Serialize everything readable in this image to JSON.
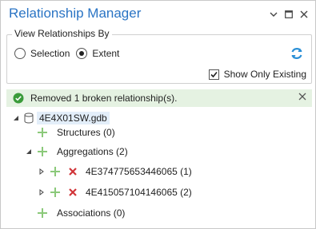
{
  "window": {
    "title": "Relationship Manager"
  },
  "view_group": {
    "label": "View Relationships By",
    "options": [
      {
        "label": "Selection",
        "selected": false
      },
      {
        "label": "Extent",
        "selected": true
      }
    ],
    "show_only_existing": {
      "label": "Show Only Existing",
      "checked": true
    }
  },
  "message": {
    "text": "Removed 1 broken relationship(s).",
    "status_color": "#3a9b3a"
  },
  "tree": {
    "root": "4E4X01SW.gdb",
    "structures": "Structures (0)",
    "aggregations": "Aggregations (2)",
    "aggregation_items": [
      {
        "label": "4E374775653446065 (1)"
      },
      {
        "label": "4E415057104146065 (2)"
      }
    ],
    "associations": "Associations (0)"
  },
  "colors": {
    "title": "#2a74c4",
    "add": "#8bc97a",
    "delete": "#d13438",
    "refresh": "#2a8fd6",
    "message_bg": "#e5f2e2"
  }
}
